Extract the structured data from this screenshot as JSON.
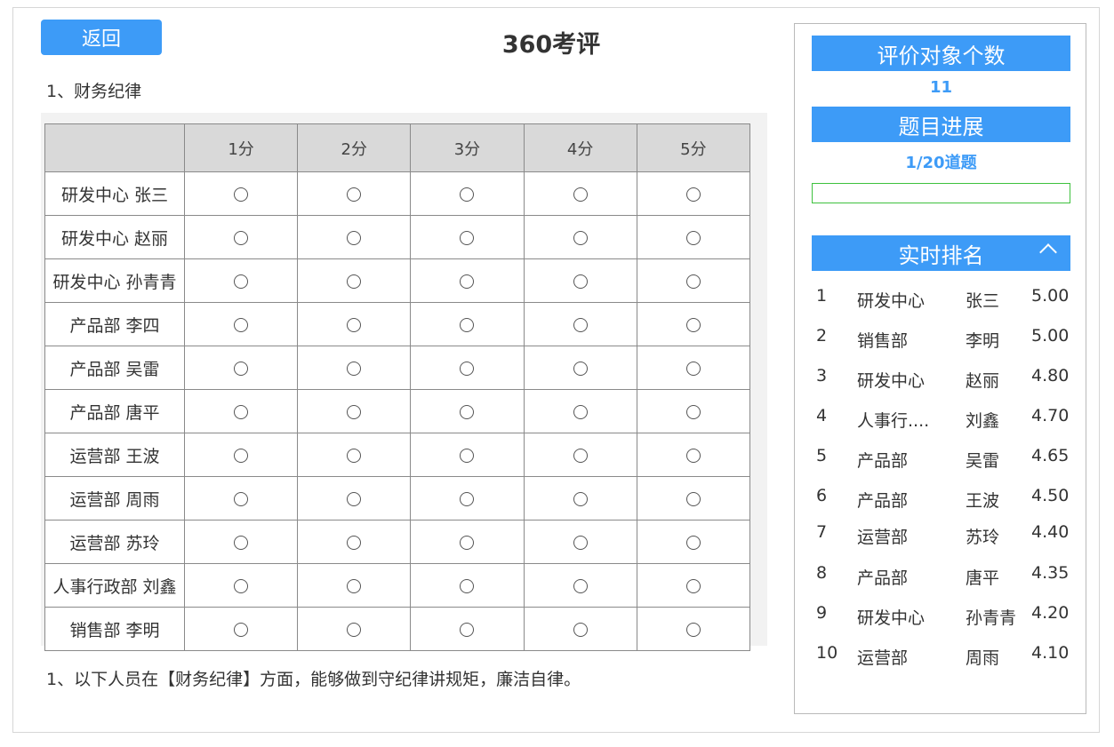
{
  "header": {
    "back_label": "返回",
    "title": "360考评"
  },
  "section": {
    "title": "1、财务纪律"
  },
  "table": {
    "columns": [
      "",
      "1分",
      "2分",
      "3分",
      "4分",
      "5分"
    ],
    "rows": [
      "研发中心 张三",
      "研发中心 赵丽",
      "研发中心 孙青青",
      "产品部 李四",
      "产品部 吴雷",
      "产品部 唐平",
      "运营部 王波",
      "运营部 周雨",
      "运营部 苏玲",
      "人事行政部 刘鑫",
      "销售部 李明"
    ]
  },
  "question": {
    "text": "1、以下人员在【财务纪律】方面，能够做到守纪律讲规矩，廉洁自律。"
  },
  "sidebar": {
    "eval_count_label": "评价对象个数",
    "eval_count_value": "11",
    "progress_label": "题目进展",
    "progress_text": "1/20道题",
    "progress_fraction": 0,
    "ranking_label": "实时排名",
    "ranking": [
      {
        "rank": "1",
        "dept": "研发中心",
        "name": "张三",
        "score": "5.00"
      },
      {
        "rank": "2",
        "dept": "销售部",
        "name": "李明",
        "score": "5.00"
      },
      {
        "rank": "3",
        "dept": "研发中心",
        "name": "赵丽",
        "score": "4.80"
      },
      {
        "rank": "4",
        "dept": "人事行....",
        "name": "刘鑫",
        "score": "4.70"
      },
      {
        "rank": "5",
        "dept": "产品部",
        "name": "吴雷",
        "score": "4.65"
      },
      {
        "rank": "6",
        "dept": "产品部",
        "name": "王波",
        "score": "4.50"
      },
      {
        "rank": "7",
        "dept": "运营部",
        "name": "苏玲",
        "score": "4.40"
      },
      {
        "rank": "8",
        "dept": "产品部",
        "name": "唐平",
        "score": "4.35"
      },
      {
        "rank": "9",
        "dept": "研发中心",
        "name": "孙青青",
        "score": "4.20"
      },
      {
        "rank": "10",
        "dept": "运营部",
        "name": "周雨",
        "score": "4.10"
      }
    ]
  },
  "colors": {
    "accent": "#3d9bf7",
    "progress": "#3ec13e",
    "header_bg": "#d9d9d9"
  }
}
